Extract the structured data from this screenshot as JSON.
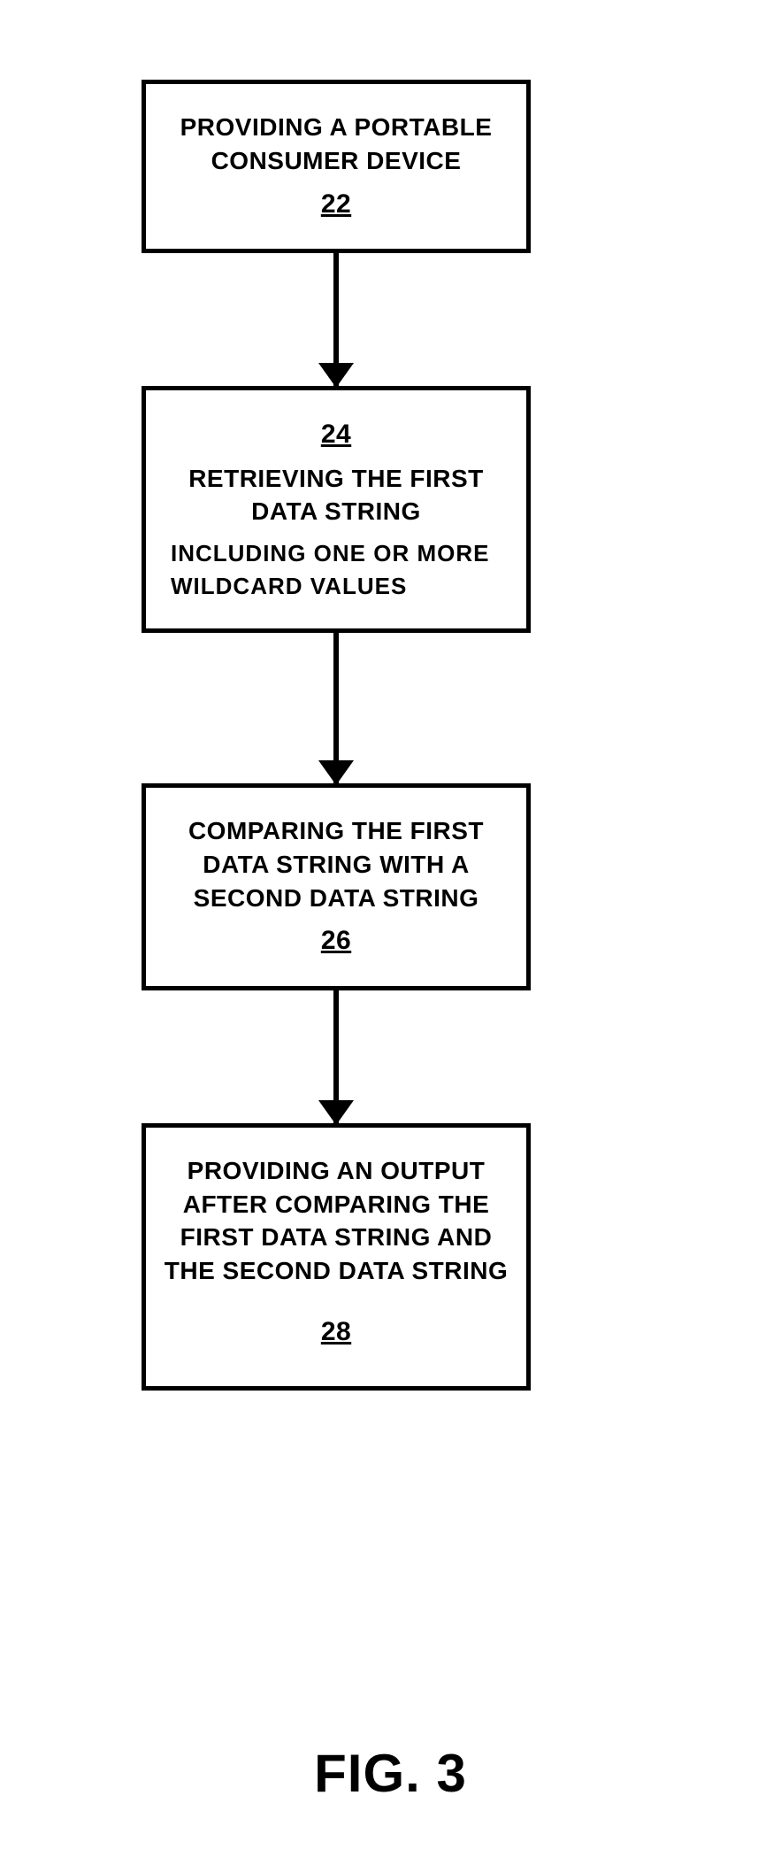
{
  "chart_data": {
    "type": "flowchart",
    "nodes": [
      {
        "id": "22",
        "text": "PROVIDING A PORTABLE CONSUMER DEVICE",
        "ref": "22"
      },
      {
        "id": "24",
        "text": "RETRIEVING THE FIRST DATA STRING",
        "annotation": "INCLUDING ONE OR MORE WILDCARD VALUES",
        "ref": "24",
        "ref_position": "top"
      },
      {
        "id": "26",
        "text": "COMPARING THE FIRST DATA STRING WITH A SECOND DATA STRING",
        "ref": "26"
      },
      {
        "id": "28",
        "text": "PROVIDING AN OUTPUT AFTER COMPARING THE FIRST DATA STRING AND THE SECOND DATA STRING",
        "ref": "28"
      }
    ],
    "edges": [
      [
        "22",
        "24"
      ],
      [
        "24",
        "26"
      ],
      [
        "26",
        "28"
      ]
    ]
  },
  "box1": {
    "text": "PROVIDING A PORTABLE CONSUMER DEVICE",
    "ref": "22"
  },
  "box2": {
    "ref": "24",
    "text": "RETRIEVING THE FIRST DATA STRING",
    "annotation": "INCLUDING ONE OR MORE WILDCARD VALUES"
  },
  "box3": {
    "text": "COMPARING THE FIRST DATA STRING WITH A SECOND DATA STRING",
    "ref": "26"
  },
  "box4": {
    "text": "PROVIDING AN OUTPUT AFTER COMPARING THE FIRST DATA STRING AND THE SECOND DATA STRING",
    "ref": "28"
  },
  "figure_label": "FIG. 3"
}
